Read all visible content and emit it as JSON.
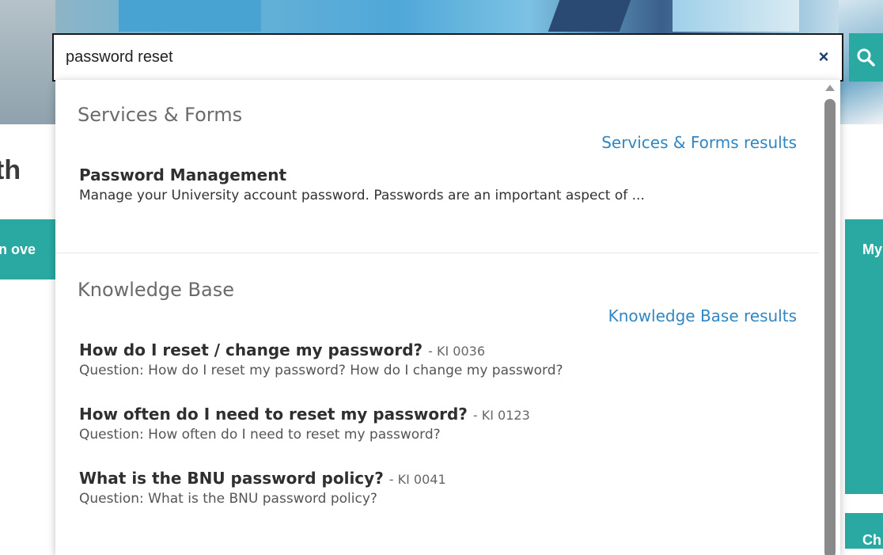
{
  "search": {
    "query": "password reset",
    "clear_symbol": "×"
  },
  "page": {
    "heading_fragment": "th",
    "left_tile_fragment": "n ove",
    "right_tile_fragment": "My",
    "right_tile2_fragment": "Ch"
  },
  "dropdown": {
    "services": {
      "title": "Services & Forms",
      "results_link": "Services & Forms results",
      "items": [
        {
          "title": "Password Management",
          "description": "Manage your University account password. Passwords are an important aspect of ..."
        }
      ]
    },
    "knowledge": {
      "title": "Knowledge Base",
      "results_link": "Knowledge Base results",
      "items": [
        {
          "title": "How do I reset / change my password?",
          "id": "- KI 0036",
          "description": "Question: How do I reset my password? How do I change my password?"
        },
        {
          "title": "How often do I need to reset my password?",
          "id": "- KI 0123",
          "description": "Question: How often do I need to reset my password?"
        },
        {
          "title": "What is the BNU password policy?",
          "id": "- KI 0041",
          "description": "Question: What is the BNU password policy?"
        }
      ]
    }
  },
  "colors": {
    "accent_teal": "#2aa9a3",
    "link_blue": "#2f86c2",
    "clear_icon_navy": "#1f3a6e"
  },
  "icons": [
    "search-icon",
    "close-icon",
    "scroll-up-arrow-icon"
  ]
}
